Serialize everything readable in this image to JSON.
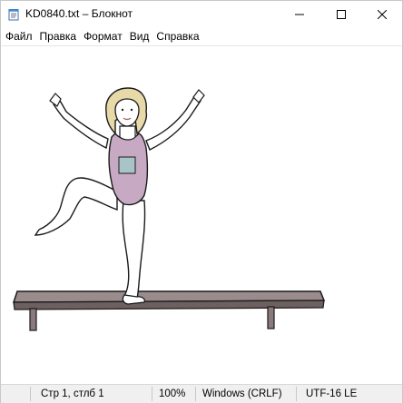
{
  "window": {
    "title": "KD0840.txt – Блокнот",
    "app_icon": "notepad-icon"
  },
  "window_controls": {
    "minimize_icon": "minimize-icon",
    "maximize_icon": "maximize-icon",
    "close_icon": "close-icon"
  },
  "menu": {
    "items": [
      "Файл",
      "Правка",
      "Формат",
      "Вид",
      "Справка"
    ]
  },
  "content": {
    "picture": "gymnast-on-bench-illustration",
    "colors": {
      "leotard": "#c7a9c4",
      "hair": "#e8d9a8",
      "skin": "#ffffff",
      "bench": "#8a7a7c",
      "outline": "#1a1a1a"
    }
  },
  "status": {
    "position": "Стр 1, стлб 1",
    "zoom": "100%",
    "line_ending": "Windows (CRLF)",
    "encoding": "UTF-16 LE"
  }
}
